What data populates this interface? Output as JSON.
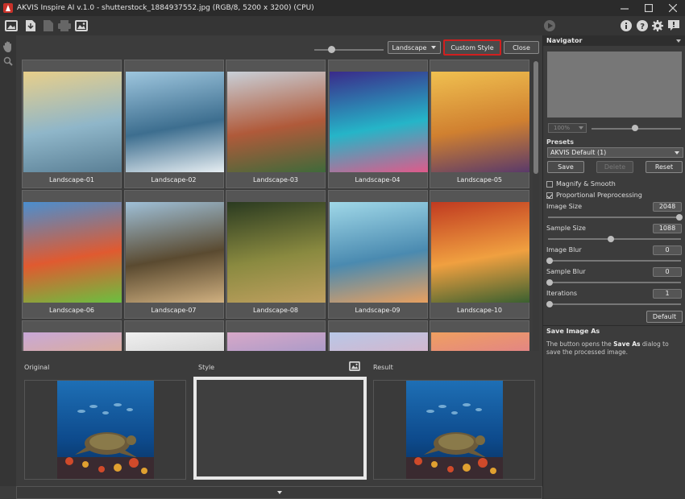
{
  "window": {
    "title": "AKVIS Inspire AI v.1.0 - shutterstock_1884937552.jpg (RGB/8, 5200 x 3200) (CPU)"
  },
  "icons": {
    "toolbar_left": [
      "open-image-icon",
      "import-icon",
      "save-icon",
      "print-icon",
      "gallery-icon"
    ],
    "toolbar_right": [
      "info-icon",
      "help-icon",
      "settings-icon",
      "feedback-icon"
    ],
    "left_tools": [
      "hand-icon",
      "zoom-icon"
    ]
  },
  "gallery": {
    "category_select": "Landscape",
    "custom_style_label": "Custom Style",
    "close_label": "Close",
    "thumbnails": [
      {
        "label": "Landscape-01",
        "colors": [
          "#e8cf8a",
          "#8fb6c9",
          "#5a7f95"
        ]
      },
      {
        "label": "Landscape-02",
        "colors": [
          "#9ec6de",
          "#3d6e8f",
          "#e7eef2"
        ]
      },
      {
        "label": "Landscape-03",
        "colors": [
          "#c9d0d8",
          "#b05a3a",
          "#3f6a3a"
        ]
      },
      {
        "label": "Landscape-04",
        "colors": [
          "#3a2a8a",
          "#25b5c8",
          "#e05a8a"
        ]
      },
      {
        "label": "Landscape-05",
        "colors": [
          "#f0c050",
          "#d08030",
          "#5a3a6a"
        ]
      },
      {
        "label": "Landscape-06",
        "colors": [
          "#4a8fd0",
          "#e05a30",
          "#6ac040"
        ]
      },
      {
        "label": "Landscape-07",
        "colors": [
          "#9fc0d8",
          "#5a4a30",
          "#d0b080"
        ]
      },
      {
        "label": "Landscape-08",
        "colors": [
          "#2a3a20",
          "#8a8a40",
          "#c0a060"
        ]
      },
      {
        "label": "Landscape-09",
        "colors": [
          "#a0d8e8",
          "#4a8ab0",
          "#e8a060"
        ]
      },
      {
        "label": "Landscape-10",
        "colors": [
          "#c03a20",
          "#f0a040",
          "#3a6030"
        ]
      },
      {
        "label": "",
        "colors": [
          "#c8a8d8",
          "#e8b070",
          "#7090c0"
        ]
      },
      {
        "label": "",
        "colors": [
          "#f0f0f0",
          "#c0c0c0",
          "#909090"
        ]
      },
      {
        "label": "",
        "colors": [
          "#d8a8c8",
          "#8890c8",
          "#f0c0a0"
        ]
      },
      {
        "label": "",
        "colors": [
          "#b8c8e8",
          "#e8a8b8",
          "#90b0d8"
        ]
      },
      {
        "label": "",
        "colors": [
          "#f0a060",
          "#d870a0",
          "#8080c0"
        ]
      }
    ]
  },
  "previews": {
    "original_label": "Original",
    "style_label": "Style",
    "result_label": "Result"
  },
  "navigator": {
    "title": "Navigator",
    "zoom": "100%"
  },
  "presets": {
    "title": "Presets",
    "selected": "AKVIS Default (1)",
    "save_label": "Save",
    "delete_label": "Delete",
    "reset_label": "Reset"
  },
  "settings": {
    "magnify_label": "Magnify & Smooth",
    "magnify_checked": false,
    "proportional_label": "Proportional Preprocessing",
    "proportional_checked": true,
    "params": [
      {
        "label": "Image Size",
        "value": "2048",
        "fraction": 1.0
      },
      {
        "label": "Sample Size",
        "value": "1088",
        "fraction": 0.47
      },
      {
        "label": "Image Blur",
        "value": "0",
        "fraction": 0.0
      },
      {
        "label": "Sample Blur",
        "value": "0",
        "fraction": 0.0
      },
      {
        "label": "Iterations",
        "value": "1",
        "fraction": 0.0
      }
    ],
    "default_label": "Default"
  },
  "help": {
    "title": "Save Image As",
    "text_pre": "The button opens the ",
    "text_bold": "Save As",
    "text_post": " dialog to save the processed image."
  }
}
